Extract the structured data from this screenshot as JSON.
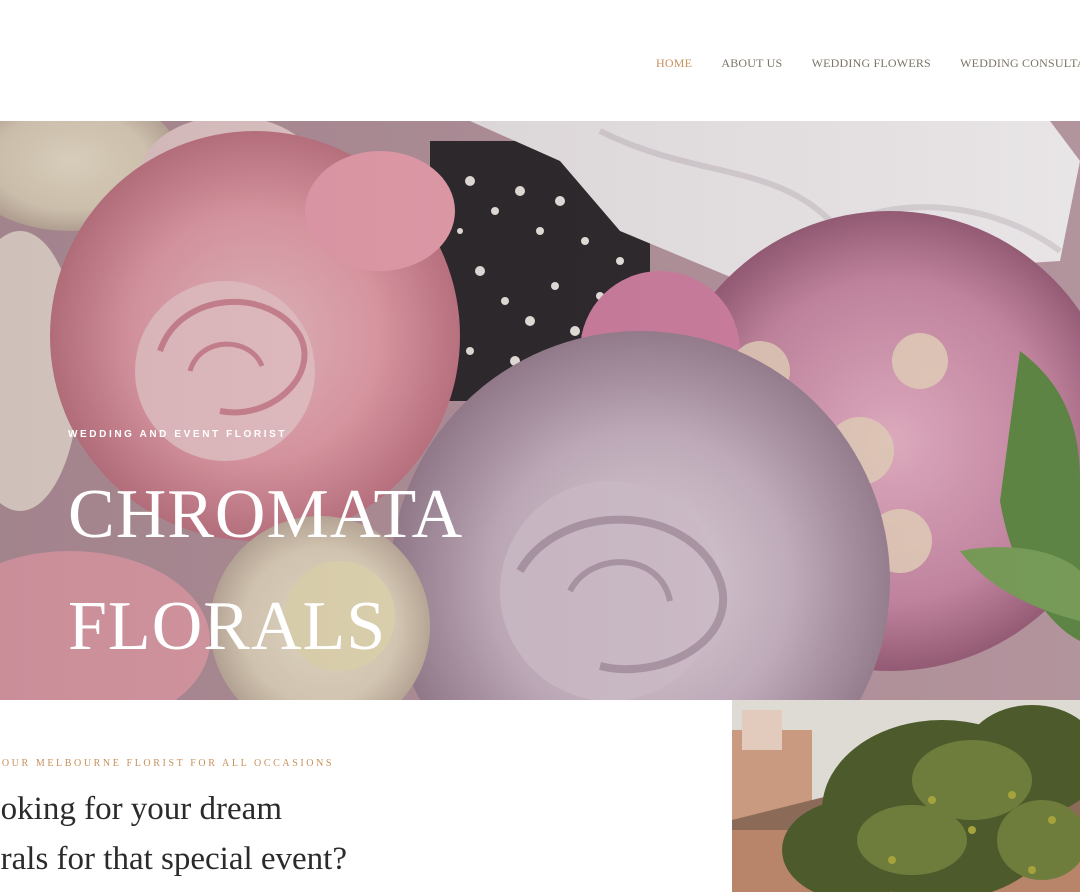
{
  "nav": {
    "items": [
      {
        "label": "HOME",
        "active": true
      },
      {
        "label": "ABOUT US",
        "active": false
      },
      {
        "label": "WEDDING FLOWERS",
        "active": false
      },
      {
        "label": "WEDDING CONSULTATION",
        "active": false
      }
    ]
  },
  "hero": {
    "kicker": "WEDDING AND EVENT FLORIST",
    "title_line1": "CHROMATA",
    "title_line2": "FLORALS"
  },
  "intro": {
    "kicker": "YOUR MELBOURNE FLORIST FOR ALL OCCASIONS",
    "heading_line1": "Looking for your dream",
    "heading_line2": "florals for that special event?"
  },
  "colors": {
    "accent": "#c8905a",
    "nav_text": "#7a7462",
    "heading_text": "#2b2b2b"
  }
}
